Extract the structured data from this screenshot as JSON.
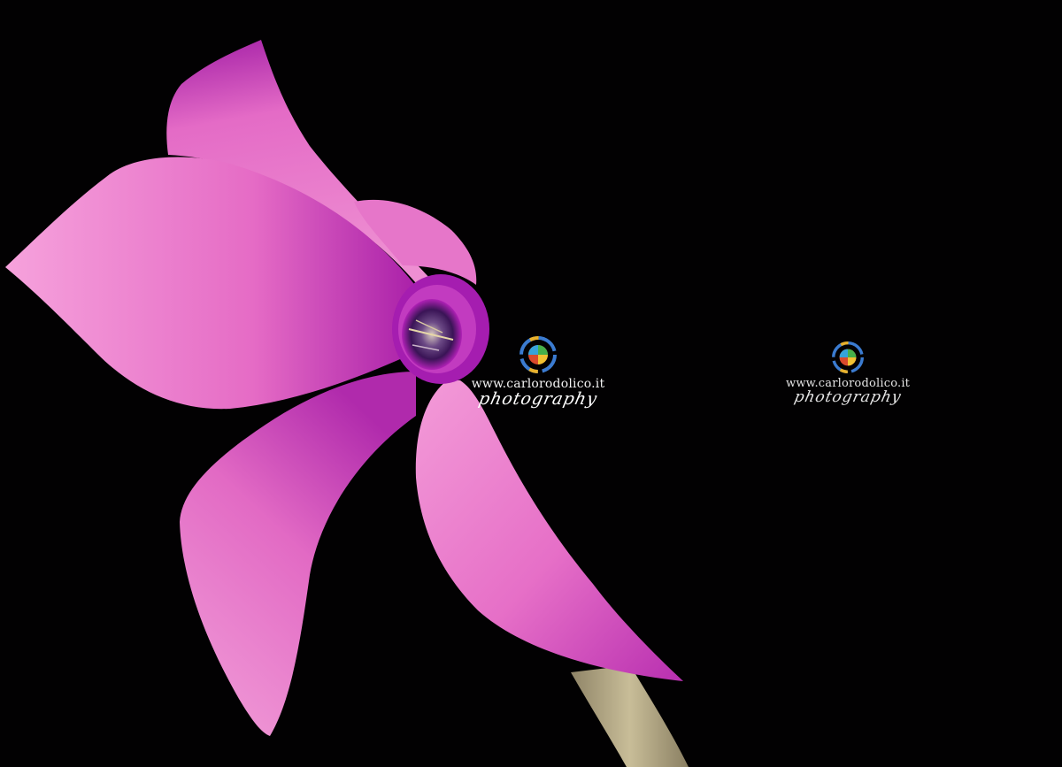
{
  "photo": {
    "subject": "cyclamen flower",
    "background_color": "#020102",
    "petal_color": "#e770c6",
    "petal_highlight": "#f7a6dd",
    "throat_color": "#a01aa8",
    "stem_color": "#b9ae8a"
  },
  "watermarks": [
    {
      "url": "www.carlorodolico.it",
      "tagline": "photography"
    },
    {
      "url": "www.carlorodolico.it",
      "tagline": "photography"
    }
  ],
  "icons": {
    "watermark_logo": "camera-lens-logo-icon"
  }
}
